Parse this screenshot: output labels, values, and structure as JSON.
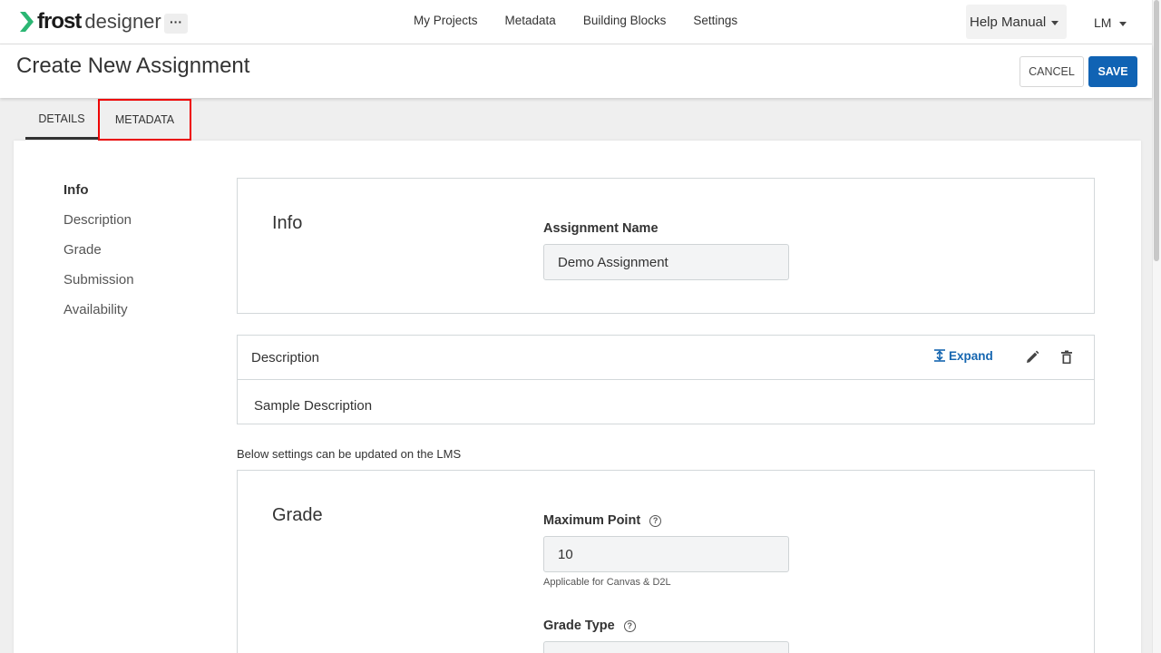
{
  "app": {
    "logo_primary": "frost",
    "logo_secondary": "designer",
    "more_label": "···",
    "nav": [
      {
        "label": "My Projects"
      },
      {
        "label": "Metadata"
      },
      {
        "label": "Building Blocks"
      },
      {
        "label": "Settings"
      }
    ],
    "help_label": "Help Manual",
    "user_initials": "LM"
  },
  "header": {
    "title": "Create New Assignment",
    "cancel_label": "CANCEL",
    "save_label": "SAVE"
  },
  "tabs": [
    {
      "label": "DETAILS",
      "active": true
    },
    {
      "label": "METADATA",
      "active": false
    }
  ],
  "side_nav": [
    {
      "label": "Info",
      "active": true
    },
    {
      "label": "Description"
    },
    {
      "label": "Grade"
    },
    {
      "label": "Submission"
    },
    {
      "label": "Availability"
    }
  ],
  "info_card": {
    "title": "Info",
    "field_label": "Assignment Name",
    "field_value": "Demo Assignment"
  },
  "description_card": {
    "title": "Description",
    "expand_label": "Expand",
    "body": "Sample Description"
  },
  "lms_note": "Below settings can be updated on the LMS",
  "grade_card": {
    "title": "Grade",
    "max_point_label": "Maximum Point",
    "max_point_value": "10",
    "max_point_hint": "Applicable for Canvas & D2L",
    "grade_type_label": "Grade Type",
    "help_glyph": "?"
  },
  "colors": {
    "accent": "#1063b4",
    "link": "#1566b0",
    "highlight_border": "#ee0000",
    "logo_green": "#2bb673"
  }
}
